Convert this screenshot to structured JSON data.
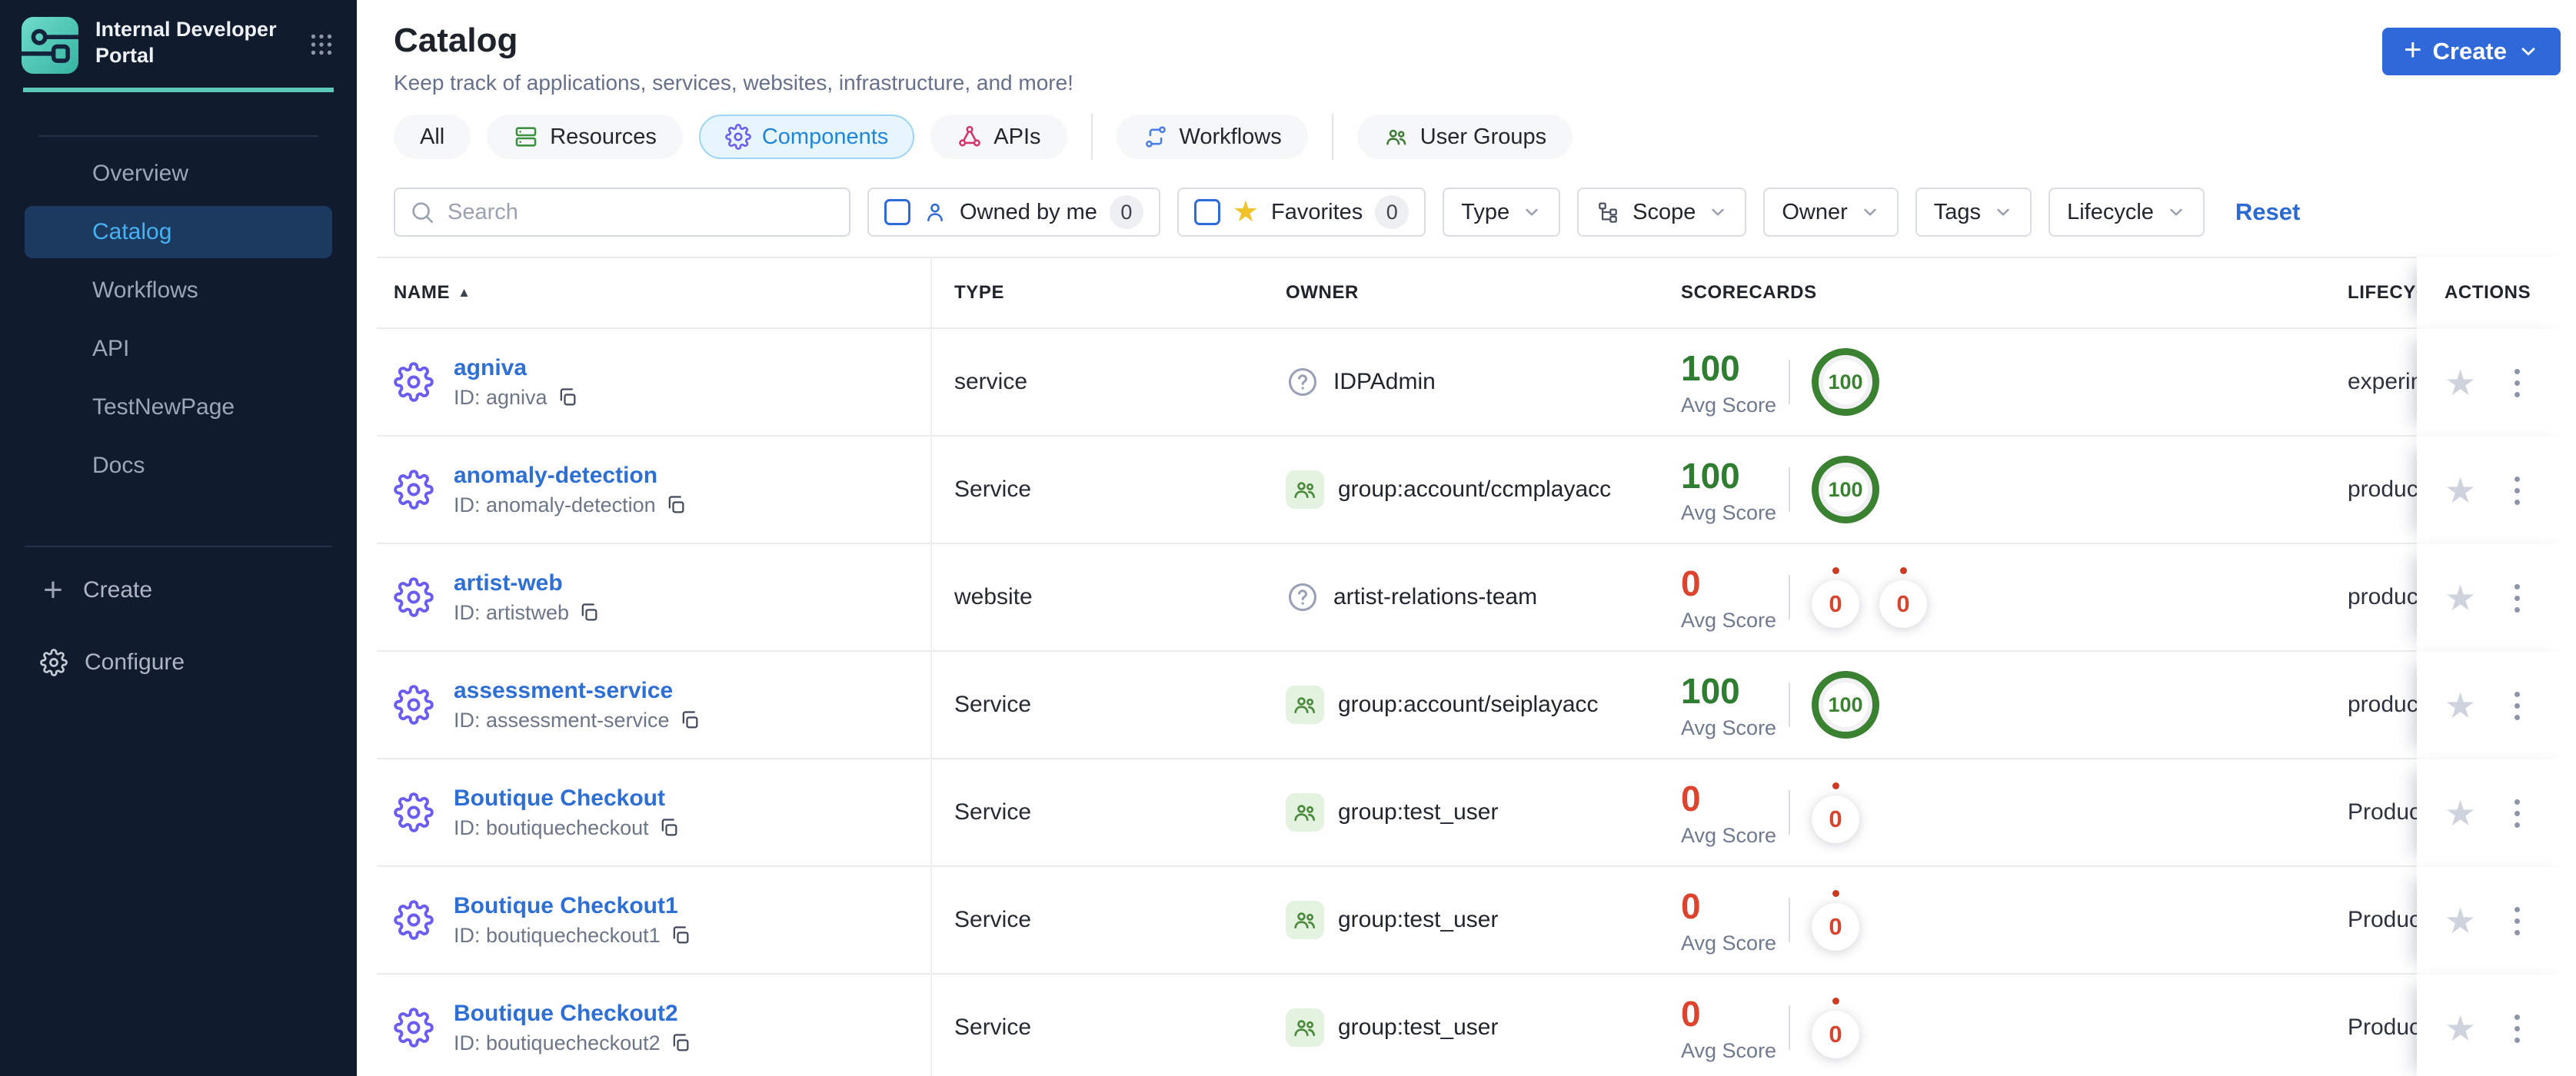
{
  "app": {
    "name": "Internal Developer Portal"
  },
  "sidebar": {
    "nav": [
      {
        "label": "Overview",
        "active": false
      },
      {
        "label": "Catalog",
        "active": true
      },
      {
        "label": "Workflows",
        "active": false
      },
      {
        "label": "API",
        "active": false
      },
      {
        "label": "TestNewPage",
        "active": false
      },
      {
        "label": "Docs",
        "active": false
      }
    ],
    "create_label": "Create",
    "configure_label": "Configure"
  },
  "page": {
    "title": "Catalog",
    "subtitle": "Keep track of applications, services, websites, infrastructure, and more!",
    "create_button_label": "Create"
  },
  "tabs": [
    {
      "label": "All",
      "selected": false
    },
    {
      "label": "Resources",
      "icon": "resources-icon",
      "selected": false
    },
    {
      "label": "Components",
      "icon": "components-icon",
      "selected": true
    },
    {
      "label": "APIs",
      "icon": "apis-icon",
      "selected": false
    },
    {
      "label": "Workflows",
      "icon": "workflows-icon",
      "selected": false
    },
    {
      "label": "User Groups",
      "icon": "user-groups-icon",
      "selected": false
    }
  ],
  "filters": {
    "search_placeholder": "Search",
    "owned_by_me": {
      "label": "Owned by me",
      "count": "0",
      "checked": false
    },
    "favorites": {
      "label": "Favorites",
      "count": "0",
      "checked": false
    },
    "dropdowns": [
      {
        "label": "Type"
      },
      {
        "label": "Scope",
        "icon": "scope-icon"
      },
      {
        "label": "Owner"
      },
      {
        "label": "Tags"
      },
      {
        "label": "Lifecycle"
      }
    ],
    "reset_label": "Reset"
  },
  "table": {
    "columns": {
      "name": "NAME",
      "type": "TYPE",
      "owner": "OWNER",
      "scorecards": "SCORECARDS",
      "lifecycle": "LIFECYCLE",
      "actions": "ACTIONS"
    },
    "sorted_by": "NAME ascending",
    "avg_score_label": "Avg Score",
    "rows": [
      {
        "name": "agniva",
        "id": "ID: agniva",
        "type": "service",
        "owner": "IDPAdmin",
        "owner_kind": "unknown",
        "avg_score": "100",
        "badges": [
          "100"
        ],
        "lifecycle": "experimental"
      },
      {
        "name": "anomaly-detection",
        "id": "ID: anomaly-detection",
        "type": "Service",
        "owner": "group:account/ccmplayacc",
        "owner_kind": "group",
        "avg_score": "100",
        "badges": [
          "100"
        ],
        "lifecycle": "production"
      },
      {
        "name": "artist-web",
        "id": "ID: artistweb",
        "type": "website",
        "owner": "artist-relations-team",
        "owner_kind": "unknown",
        "avg_score": "0",
        "badges": [
          "0",
          "0"
        ],
        "lifecycle": "production"
      },
      {
        "name": "assessment-service",
        "id": "ID: assessment-service",
        "type": "Service",
        "owner": "group:account/seiplayacc",
        "owner_kind": "group",
        "avg_score": "100",
        "badges": [
          "100"
        ],
        "lifecycle": "production"
      },
      {
        "name": "Boutique Checkout",
        "id": "ID: boutiquecheckout",
        "type": "Service",
        "owner": "group:test_user",
        "owner_kind": "group",
        "avg_score": "0",
        "badges": [
          "0"
        ],
        "lifecycle": "Production"
      },
      {
        "name": "Boutique Checkout1",
        "id": "ID: boutiquecheckout1",
        "type": "Service",
        "owner": "group:test_user",
        "owner_kind": "group",
        "avg_score": "0",
        "badges": [
          "0"
        ],
        "lifecycle": "Production"
      },
      {
        "name": "Boutique Checkout2",
        "id": "ID: boutiquecheckout2",
        "type": "Service",
        "owner": "group:test_user",
        "owner_kind": "group",
        "avg_score": "0",
        "badges": [
          "0"
        ],
        "lifecycle": "Production"
      }
    ]
  },
  "colors": {
    "sidebar_bg": "#101b2e",
    "sidebar_active_bg": "#1c3a60",
    "sidebar_active_text": "#47b2f3",
    "teal_accent": "#5bc9ba",
    "primary_button_blue": "#2f68d9",
    "link_blue": "#2e6fd6",
    "selected_tab_bg": "#e7f5fe",
    "selected_tab_text": "#2186d8",
    "score_green": "#2e7d31",
    "score_red": "#dd4430",
    "star_yellow": "#f1c32a",
    "gear_purple": "#6a5cf0",
    "api_pink": "#d6336c",
    "resource_green": "#3d9142",
    "workflow_blue": "#4a7ee8",
    "usergroup_green": "#3f7d36"
  }
}
